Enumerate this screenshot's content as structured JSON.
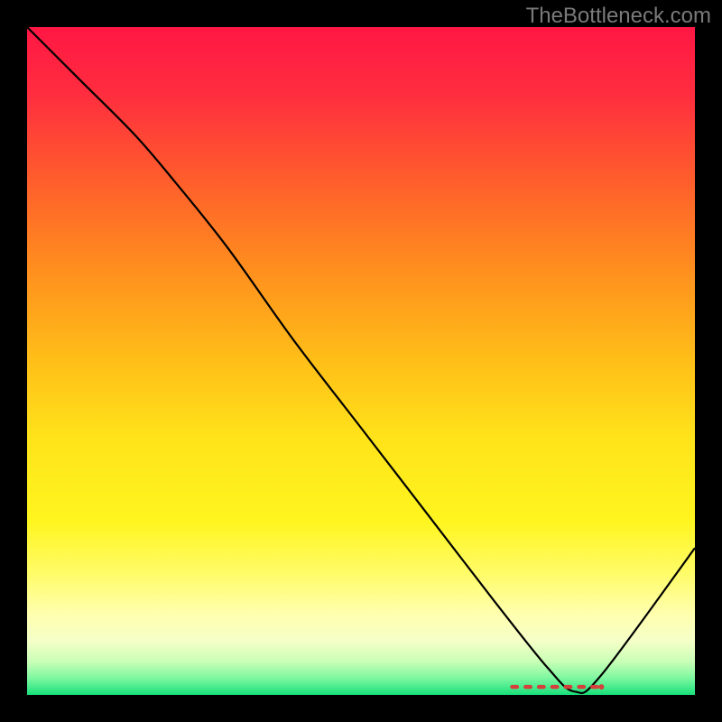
{
  "watermark": "TheBottleneck.com",
  "chart_data": {
    "type": "line",
    "title": "",
    "xlabel": "",
    "ylabel": "",
    "xlim": [
      0,
      100
    ],
    "ylim": [
      0,
      100
    ],
    "grid": false,
    "background_gradient": {
      "stops": [
        {
          "offset": 0.0,
          "color": "#ff1744"
        },
        {
          "offset": 0.1,
          "color": "#ff2d3f"
        },
        {
          "offset": 0.22,
          "color": "#ff5a2d"
        },
        {
          "offset": 0.35,
          "color": "#ff8a1f"
        },
        {
          "offset": 0.5,
          "color": "#ffbf18"
        },
        {
          "offset": 0.62,
          "color": "#ffe41a"
        },
        {
          "offset": 0.74,
          "color": "#fff51f"
        },
        {
          "offset": 0.82,
          "color": "#fffc6a"
        },
        {
          "offset": 0.88,
          "color": "#ffffb0"
        },
        {
          "offset": 0.92,
          "color": "#f4ffc7"
        },
        {
          "offset": 0.95,
          "color": "#c9ffb6"
        },
        {
          "offset": 0.975,
          "color": "#7df7a0"
        },
        {
          "offset": 1.0,
          "color": "#18e07a"
        }
      ]
    },
    "series": [
      {
        "name": "bottleneck-curve",
        "color": "#000000",
        "width": 2.2,
        "x": [
          0.0,
          8.0,
          16.0,
          22.0,
          30.0,
          40.0,
          50.0,
          60.0,
          70.0,
          78.0,
          82.0,
          86.0,
          100.0
        ],
        "y": [
          100.0,
          92.0,
          84.0,
          77.0,
          67.0,
          53.0,
          40.0,
          27.0,
          14.0,
          4.0,
          0.5,
          3.0,
          22.0
        ]
      }
    ],
    "markers": {
      "name": "optimal-band",
      "color": "#d4413c",
      "y": 1.2,
      "x_start": 72.0,
      "x_end": 86.0,
      "dash_count": 7
    }
  }
}
